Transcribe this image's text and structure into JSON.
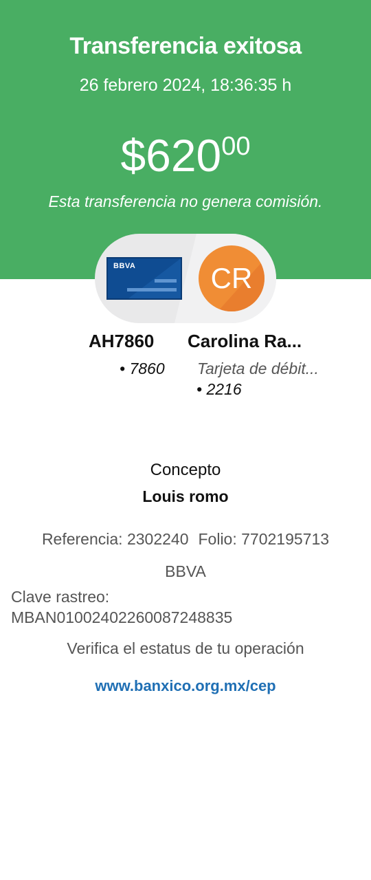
{
  "header": {
    "title": "Transferencia exitosa",
    "datetime": "26 febrero 2024, 18:36:35 h",
    "amount_main": "$620",
    "amount_cents": "00",
    "commission_note": "Esta transferencia no genera comisión.",
    "bg_color": "#49ae63"
  },
  "origin": {
    "bank_logo_text": "BBVA",
    "name": "AH7860",
    "account": "• 7860",
    "card_color": "#0f4c92"
  },
  "destination": {
    "initials": "CR",
    "name": "Carolina Ra...",
    "account_type": "Tarjeta de débit...",
    "account": "• 2216",
    "avatar_color": "#f08d35"
  },
  "details": {
    "concept_label": "Concepto",
    "concept_value": "Louis romo",
    "reference": "Referencia: 2302240",
    "folio": "Folio: 7702195713",
    "bank": "BBVA",
    "clave_label": "Clave rastreo:",
    "clave_value": "MBAN01002402260087248835",
    "verify_text": "Verifica el estatus de tu operación",
    "verify_link": "www.banxico.org.mx/cep",
    "link_color": "#1f6fb4"
  }
}
